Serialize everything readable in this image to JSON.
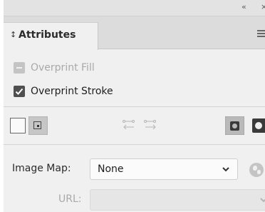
{
  "panel": {
    "topbar": {
      "collapse_glyph": "«",
      "close_glyph": "×"
    },
    "tab": {
      "arrows_glyph": "↕",
      "label": "Attributes"
    },
    "menu_icon": "menu-icon"
  },
  "checkboxes": {
    "overprint_fill": {
      "label": "Overprint Fill",
      "checked": false,
      "enabled": false
    },
    "overprint_stroke": {
      "label": "Overprint Stroke",
      "checked": true,
      "enabled": true
    }
  },
  "image_map": {
    "label": "Image Map:",
    "value": "None",
    "url_label": "URL:",
    "url_value": ""
  },
  "colors": {
    "panel_bg": "#f0f0f0",
    "tab_bar_bg": "#dcdcdc",
    "checkbox_checked": "#4f4f4f",
    "disabled": "#c4c4c4"
  }
}
